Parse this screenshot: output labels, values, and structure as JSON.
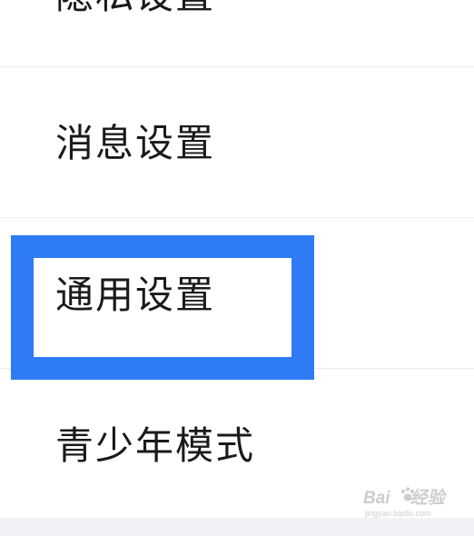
{
  "settings_menu": {
    "items": [
      {
        "label": "隐私设置"
      },
      {
        "label": "消息设置"
      },
      {
        "label": "通用设置"
      },
      {
        "label": "青少年模式"
      }
    ]
  },
  "annotation": {
    "highlight_color": "#2f7bf5"
  },
  "watermark": {
    "brand_prefix": "Bai",
    "brand_suffix": "经验",
    "url": "jingyan.baidu.com"
  }
}
